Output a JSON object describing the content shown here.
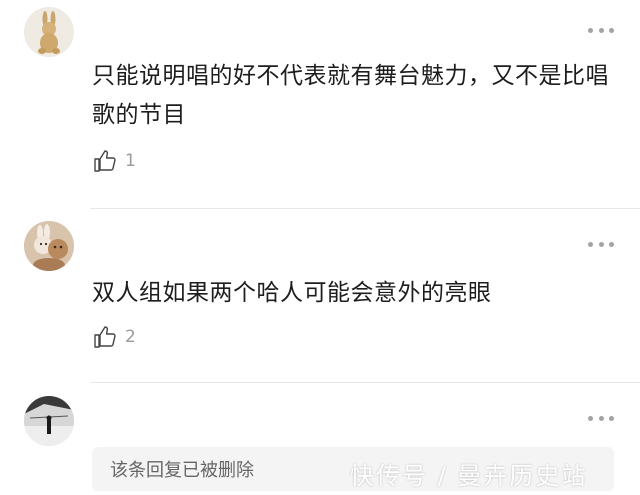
{
  "comments": [
    {
      "text": "只能说明唱的好不代表就有舞台魅力，又不是比唱歌的节目",
      "likes": "1",
      "avatar_icon": "rabbit-plush-avatar"
    },
    {
      "text": "双人组如果两个哈人可能会意外的亮眼",
      "likes": "2",
      "avatar_icon": "plush-toys-avatar"
    },
    {
      "deleted_reply": "该条回复已被删除",
      "avatar_icon": "bw-photo-avatar"
    }
  ],
  "watermark": "快传号 / 曼卉历史站",
  "colors": {
    "text": "#1d1d1d",
    "muted": "#9a9a9a",
    "divider": "#e8e8e8",
    "deleted_bg": "#f4f4f4"
  }
}
